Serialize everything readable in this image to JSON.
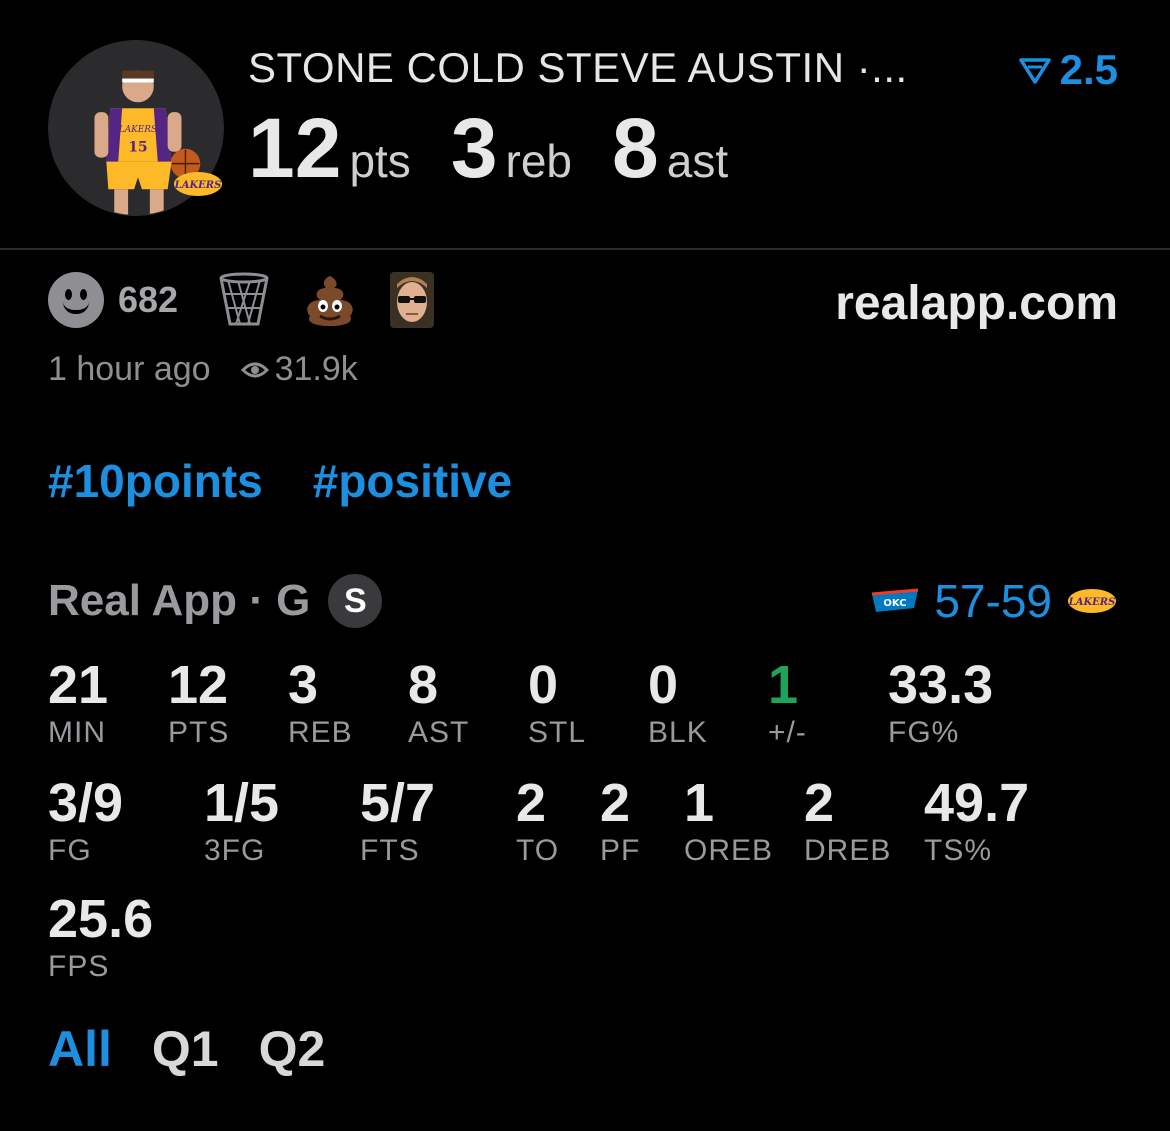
{
  "header": {
    "player_name": "STONE COLD STEVE AUSTIN ·...",
    "line_value": "2.5",
    "headline_stats": [
      {
        "value": "12",
        "unit": "pts"
      },
      {
        "value": "3",
        "unit": "reb"
      },
      {
        "value": "8",
        "unit": "ast"
      }
    ],
    "avatar_jersey_number": "15",
    "avatar_team_text": "LAKERS",
    "team_logo_text": "LAKERS"
  },
  "reactions": {
    "count": "682",
    "icons": [
      "smiley-icon",
      "basketball-net-icon",
      "poop-emoji-icon",
      "sunglasses-avatar-icon"
    ]
  },
  "site": "realapp.com",
  "meta": {
    "time": "1 hour ago",
    "views": "31.9k"
  },
  "tags": [
    "#10points",
    "#positive"
  ],
  "game": {
    "label": "Real App · G",
    "badge": "S",
    "away_logo_text": "OKC",
    "score": "57-59",
    "home_logo_text": "LAKERS"
  },
  "stats": {
    "row1": [
      {
        "value": "21",
        "label": "MIN"
      },
      {
        "value": "12",
        "label": "PTS"
      },
      {
        "value": "3",
        "label": "REB"
      },
      {
        "value": "8",
        "label": "AST"
      },
      {
        "value": "0",
        "label": "STL"
      },
      {
        "value": "0",
        "label": "BLK"
      },
      {
        "value": "1",
        "label": "+/-"
      },
      {
        "value": "33.3",
        "label": "FG%"
      }
    ],
    "row2": [
      {
        "value": "3/9",
        "label": "FG"
      },
      {
        "value": "1/5",
        "label": "3FG"
      },
      {
        "value": "5/7",
        "label": "FTS"
      },
      {
        "value": "2",
        "label": "TO"
      },
      {
        "value": "2",
        "label": "PF"
      },
      {
        "value": "1",
        "label": "OREB"
      },
      {
        "value": "2",
        "label": "DREB"
      },
      {
        "value": "49.7",
        "label": "TS%"
      }
    ],
    "row3": [
      {
        "value": "25.6",
        "label": "FPS"
      }
    ]
  },
  "periods": [
    "All",
    "Q1",
    "Q2"
  ],
  "colors": {
    "accent": "#1d8fe0",
    "positive": "#1fa35b",
    "muted": "#9a9a9e",
    "lakers_purple": "#552583",
    "lakers_gold": "#fdb927"
  }
}
